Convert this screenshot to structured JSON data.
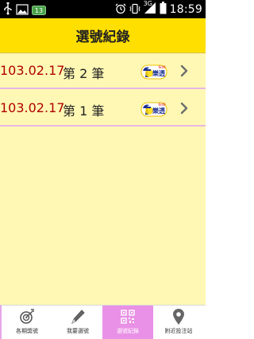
{
  "status_bar": {
    "time": "18:59",
    "network": "3G",
    "notification_count": "13",
    "icons": [
      "usb-icon",
      "image-icon",
      "notification-badge",
      "alarm-icon",
      "vibrate-icon",
      "signal-icon",
      "battery-icon"
    ]
  },
  "header": {
    "title": "選號紀錄"
  },
  "records": [
    {
      "date": "103.02.17",
      "label": "第 2 筆",
      "game": "lotto-logo"
    },
    {
      "date": "103.02.17",
      "label": "第 1 筆",
      "game": "lotto-logo"
    }
  ],
  "tabs": [
    {
      "label": "各期獎號",
      "icon": "target-icon",
      "active": false
    },
    {
      "label": "我要選號",
      "icon": "pencil-icon",
      "active": false
    },
    {
      "label": "選號紀錄",
      "icon": "qr-code-icon",
      "active": true
    },
    {
      "label": "附近投注站",
      "icon": "map-pin-icon",
      "active": false
    }
  ],
  "colors": {
    "header_bg": "#ffdf00",
    "content_bg": "#fff8b4",
    "date_text": "#b00000",
    "divider": "#e8b6e4",
    "tab_active": "#e991e6"
  }
}
